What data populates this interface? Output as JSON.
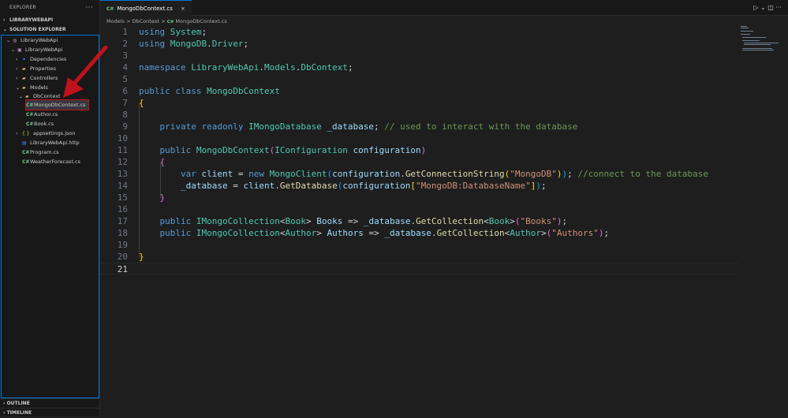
{
  "explorer": {
    "title": "EXPLORER",
    "more": "···",
    "project_section": "LIBRARYWEBAPI",
    "solution_section": "SOLUTION EXPLORER",
    "tree": [
      {
        "label": "LibraryWebApi",
        "chevron": "⌄",
        "icon": "◍"
      },
      {
        "label": "LibraryWebApi",
        "chevron": "⌄",
        "icon": "▣"
      },
      {
        "label": "Dependencies",
        "chevron": "›",
        "icon": "⚭"
      },
      {
        "label": "Properties",
        "chevron": "›",
        "icon": "▰"
      },
      {
        "label": "Controllers",
        "chevron": "›",
        "icon": "▰"
      },
      {
        "label": "Models",
        "chevron": "⌄",
        "icon": "▰"
      },
      {
        "label": "DbContext",
        "chevron": "⌄",
        "icon": "▰"
      },
      {
        "label": "MongoDbContext.cs",
        "chevron": "",
        "icon": "C#"
      },
      {
        "label": "Author.cs",
        "chevron": "",
        "icon": "C#"
      },
      {
        "label": "Book.cs",
        "chevron": "",
        "icon": "C#"
      },
      {
        "label": "appsettings.json",
        "chevron": "›",
        "icon": "{ }"
      },
      {
        "label": "LibraryWebApi.http",
        "chevron": "",
        "icon": "▤"
      },
      {
        "label": "Program.cs",
        "chevron": "",
        "icon": "C#"
      },
      {
        "label": "WeatherForecast.cs",
        "chevron": "",
        "icon": "C#"
      }
    ],
    "outline": "OUTLINE",
    "timeline": "TIMELINE"
  },
  "tab": {
    "icon": "C#",
    "label": "MongoDbContext.cs",
    "close": "×"
  },
  "top_actions": "▷ ⌄  ◫  ···",
  "breadcrumb": {
    "models": "Models",
    "sep1": ">",
    "dbcontext": "DbContext",
    "sep2": ">",
    "icon": "C#",
    "file": "MongoDbContext.cs"
  },
  "line_numbers": [
    "1",
    "2",
    "3",
    "4",
    "5",
    "6",
    "7",
    "8",
    "9",
    "10",
    "11",
    "12",
    "13",
    "14",
    "15",
    "16",
    "17",
    "18",
    "19",
    "20",
    "21"
  ],
  "code": {
    "l1": [
      "using",
      " ",
      "System",
      ";"
    ],
    "l2": [
      "using",
      " ",
      "MongoDB",
      ".",
      "Driver",
      ";"
    ],
    "l4": [
      "namespace",
      " ",
      "LibraryWebApi",
      ".",
      "Models",
      ".",
      "DbContext",
      ";"
    ],
    "l6": [
      "public",
      " ",
      "class",
      " ",
      "MongoDbContext"
    ],
    "l7": [
      "{"
    ],
    "l9": [
      "    ",
      "private",
      " ",
      "readonly",
      " ",
      "IMongoDatabase",
      " ",
      "_database",
      "; ",
      "// used to interact with the database"
    ],
    "l11": [
      "    ",
      "public",
      " ",
      "MongoDbContext",
      "(",
      "IConfiguration",
      " ",
      "configuration",
      ")"
    ],
    "l12": [
      "    ",
      "{"
    ],
    "l13": [
      "        ",
      "var",
      " ",
      "client",
      " = ",
      "new",
      " ",
      "MongoClient",
      "(",
      "configuration",
      ".",
      "GetConnectionString",
      "(",
      "\"MongoDB\"",
      ")",
      ")",
      "; ",
      "//connect to the database"
    ],
    "l14": [
      "        ",
      "_database",
      " = ",
      "client",
      ".",
      "GetDatabase",
      "(",
      "configuration",
      "[",
      "\"MongoDB:DatabaseName\"",
      "]",
      ")",
      ";"
    ],
    "l15": [
      "    ",
      "}"
    ],
    "l17": [
      "    ",
      "public",
      " ",
      "IMongoCollection",
      "<",
      "Book",
      "> ",
      "Books",
      " => ",
      "_database",
      ".",
      "GetCollection",
      "<",
      "Book",
      ">",
      "(",
      "\"Books\"",
      ")",
      ";"
    ],
    "l18": [
      "    ",
      "public",
      " ",
      "IMongoCollection",
      "<",
      "Author",
      "> ",
      "Authors",
      " => ",
      "_database",
      ".",
      "GetCollection",
      "<",
      "Author",
      ">",
      "(",
      "\"Authors\"",
      ")",
      ";"
    ],
    "l20": [
      "}"
    ]
  },
  "colors": {
    "highlight_box": "#c0121c",
    "accent": "#0078d4"
  }
}
